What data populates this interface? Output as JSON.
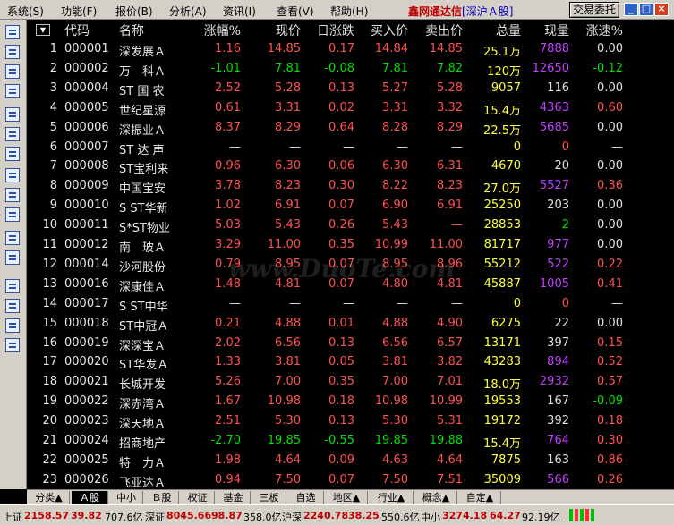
{
  "menu": [
    "系统(S)",
    "功能(F)",
    "报价(B)",
    "分析(A)",
    "资讯(I)",
    "查看(V)",
    "帮助(H)"
  ],
  "app_title": "鑫网通达信",
  "market": "[深沪Ａ股]",
  "trade_button": "交易委托",
  "window_buttons": [
    "_",
    "□",
    "×"
  ],
  "sort_arrow": "▼",
  "columns": [
    "代码",
    "名称",
    "涨幅%",
    "现价",
    "日涨跌",
    "买入价",
    "卖出价",
    "总量",
    "现量",
    "涨速%"
  ],
  "watermark": "www.DuoTe.com",
  "rows": [
    {
      "idx": "1",
      "code": "000001",
      "name": "深发展Ａ",
      "chg": "1.16",
      "price": "14.85",
      "daychg": "0.17",
      "bid": "14.84",
      "ask": "14.85",
      "vol": "25.1万",
      "cur": "7888",
      "speed": "0.00",
      "dir": "up",
      "curc": "magenta",
      "spdc": "flat"
    },
    {
      "idx": "2",
      "code": "000002",
      "name": "万　科Ａ",
      "chg": "-1.01",
      "price": "7.81",
      "daychg": "-0.08",
      "bid": "7.81",
      "ask": "7.82",
      "vol": "120万",
      "cur": "12650",
      "speed": "-0.12",
      "dir": "down",
      "curc": "magenta",
      "spdc": "down"
    },
    {
      "idx": "3",
      "code": "000004",
      "name": "ST 国 农",
      "chg": "2.52",
      "price": "5.28",
      "daychg": "0.13",
      "bid": "5.27",
      "ask": "5.28",
      "vol": "9057",
      "cur": "116",
      "speed": "0.00",
      "dir": "up",
      "curc": "white",
      "spdc": "flat"
    },
    {
      "idx": "4",
      "code": "000005",
      "name": "世纪星源",
      "chg": "0.61",
      "price": "3.31",
      "daychg": "0.02",
      "bid": "3.31",
      "ask": "3.32",
      "vol": "15.4万",
      "cur": "4363",
      "speed": "0.60",
      "dir": "up",
      "curc": "magenta",
      "spdc": "up"
    },
    {
      "idx": "5",
      "code": "000006",
      "name": "深振业Ａ",
      "chg": "8.37",
      "price": "8.29",
      "daychg": "0.64",
      "bid": "8.28",
      "ask": "8.29",
      "vol": "22.5万",
      "cur": "5685",
      "speed": "0.00",
      "dir": "up",
      "curc": "magenta",
      "spdc": "flat"
    },
    {
      "idx": "6",
      "code": "000007",
      "name": "ST 达 声",
      "chg": "—",
      "price": "—",
      "daychg": "—",
      "bid": "—",
      "ask": "—",
      "vol": "0",
      "cur": "0",
      "speed": "—",
      "dir": "flat",
      "curc": "up",
      "spdc": "flat"
    },
    {
      "idx": "7",
      "code": "000008",
      "name": "ST宝利来",
      "chg": "0.96",
      "price": "6.30",
      "daychg": "0.06",
      "bid": "6.30",
      "ask": "6.31",
      "vol": "4670",
      "cur": "20",
      "speed": "0.00",
      "dir": "up",
      "curc": "white",
      "spdc": "flat"
    },
    {
      "idx": "8",
      "code": "000009",
      "name": "中国宝安",
      "chg": "3.78",
      "price": "8.23",
      "daychg": "0.30",
      "bid": "8.22",
      "ask": "8.23",
      "vol": "27.0万",
      "cur": "5527",
      "speed": "0.36",
      "dir": "up",
      "curc": "magenta",
      "spdc": "up"
    },
    {
      "idx": "9",
      "code": "000010",
      "name": "S ST华新",
      "chg": "1.02",
      "price": "6.91",
      "daychg": "0.07",
      "bid": "6.90",
      "ask": "6.91",
      "vol": "25250",
      "cur": "203",
      "speed": "0.00",
      "dir": "up",
      "curc": "white",
      "spdc": "flat"
    },
    {
      "idx": "10",
      "code": "000011",
      "name": "S*ST物业",
      "chg": "5.03",
      "price": "5.43",
      "daychg": "0.26",
      "bid": "5.43",
      "ask": "—",
      "vol": "28853",
      "cur": "2",
      "speed": "0.00",
      "dir": "up",
      "curc": "down",
      "spdc": "flat"
    },
    {
      "idx": "11",
      "code": "000012",
      "name": "南　玻Ａ",
      "chg": "3.29",
      "price": "11.00",
      "daychg": "0.35",
      "bid": "10.99",
      "ask": "11.00",
      "vol": "81717",
      "cur": "977",
      "speed": "0.00",
      "dir": "up",
      "curc": "magenta",
      "spdc": "flat"
    },
    {
      "idx": "12",
      "code": "000014",
      "name": "沙河股份",
      "chg": "0.79",
      "price": "8.95",
      "daychg": "0.07",
      "bid": "8.95",
      "ask": "8.96",
      "vol": "55212",
      "cur": "522",
      "speed": "0.22",
      "dir": "up",
      "curc": "magenta",
      "spdc": "up"
    },
    {
      "idx": "13",
      "code": "000016",
      "name": "深康佳Ａ",
      "chg": "1.48",
      "price": "4.81",
      "daychg": "0.07",
      "bid": "4.80",
      "ask": "4.81",
      "vol": "45887",
      "cur": "1005",
      "speed": "0.41",
      "dir": "up",
      "curc": "magenta",
      "spdc": "up"
    },
    {
      "idx": "14",
      "code": "000017",
      "name": "S ST中华",
      "chg": "—",
      "price": "—",
      "daychg": "—",
      "bid": "—",
      "ask": "—",
      "vol": "0",
      "cur": "0",
      "speed": "—",
      "dir": "flat",
      "curc": "up",
      "spdc": "flat"
    },
    {
      "idx": "15",
      "code": "000018",
      "name": "ST中冠Ａ",
      "chg": "0.21",
      "price": "4.88",
      "daychg": "0.01",
      "bid": "4.88",
      "ask": "4.90",
      "vol": "6275",
      "cur": "22",
      "speed": "0.00",
      "dir": "up",
      "curc": "white",
      "spdc": "flat"
    },
    {
      "idx": "16",
      "code": "000019",
      "name": "深深宝Ａ",
      "chg": "2.02",
      "price": "6.56",
      "daychg": "0.13",
      "bid": "6.56",
      "ask": "6.57",
      "vol": "13171",
      "cur": "397",
      "speed": "0.15",
      "dir": "up",
      "curc": "white",
      "spdc": "up"
    },
    {
      "idx": "17",
      "code": "000020",
      "name": "ST华发Ａ",
      "chg": "1.33",
      "price": "3.81",
      "daychg": "0.05",
      "bid": "3.81",
      "ask": "3.82",
      "vol": "43283",
      "cur": "894",
      "speed": "0.52",
      "dir": "up",
      "curc": "magenta",
      "spdc": "up"
    },
    {
      "idx": "18",
      "code": "000021",
      "name": "长城开发",
      "chg": "5.26",
      "price": "7.00",
      "daychg": "0.35",
      "bid": "7.00",
      "ask": "7.01",
      "vol": "18.0万",
      "cur": "2932",
      "speed": "0.57",
      "dir": "up",
      "curc": "magenta",
      "spdc": "up"
    },
    {
      "idx": "19",
      "code": "000022",
      "name": "深赤湾Ａ",
      "chg": "1.67",
      "price": "10.98",
      "daychg": "0.18",
      "bid": "10.98",
      "ask": "10.99",
      "vol": "19553",
      "cur": "167",
      "speed": "-0.09",
      "dir": "up",
      "curc": "white",
      "spdc": "down"
    },
    {
      "idx": "20",
      "code": "000023",
      "name": "深天地Ａ",
      "chg": "2.51",
      "price": "5.30",
      "daychg": "0.13",
      "bid": "5.30",
      "ask": "5.31",
      "vol": "19172",
      "cur": "392",
      "speed": "0.18",
      "dir": "up",
      "curc": "white",
      "spdc": "up"
    },
    {
      "idx": "21",
      "code": "000024",
      "name": "招商地产",
      "chg": "-2.70",
      "price": "19.85",
      "daychg": "-0.55",
      "bid": "19.85",
      "ask": "19.88",
      "vol": "15.4万",
      "cur": "764",
      "speed": "0.30",
      "dir": "down",
      "curc": "magenta",
      "spdc": "up"
    },
    {
      "idx": "22",
      "code": "000025",
      "name": "特　力Ａ",
      "chg": "1.98",
      "price": "4.64",
      "daychg": "0.09",
      "bid": "4.63",
      "ask": "4.64",
      "vol": "7875",
      "cur": "163",
      "speed": "0.86",
      "dir": "up",
      "curc": "white",
      "spdc": "up"
    },
    {
      "idx": "23",
      "code": "000026",
      "name": "飞亚达Ａ",
      "chg": "0.94",
      "price": "7.50",
      "daychg": "0.07",
      "bid": "7.50",
      "ask": "7.51",
      "vol": "35009",
      "cur": "566",
      "speed": "0.26",
      "dir": "up",
      "curc": "magenta",
      "spdc": "up"
    }
  ],
  "tabs": [
    "分类▲",
    "Ａ股",
    "中小",
    "Ｂ股",
    "权证",
    "基金",
    "三板",
    "自选",
    "地区▲",
    "行业▲",
    "概念▲",
    "自定▲"
  ],
  "active_tab": "Ａ股",
  "status": {
    "sh_label": "上证",
    "sh_index": "2158.57",
    "sh_chg": "39.82",
    "sh_amt": "707.6亿",
    "sz_label": "深证",
    "sz_index": "8045.66",
    "sz_chg": "98.87",
    "sz_amt": "358.0亿",
    "hs_label": "沪深",
    "hs_index": "2240.78",
    "hs_chg": "38.25",
    "hs_amt": "550.6亿",
    "zx_label": "中小",
    "zx_index": "3274.18",
    "zx_chg": "64.27",
    "zx_amt": "92.19亿"
  },
  "colors": {
    "up": "#ff5050",
    "down": "#00e000",
    "bg": "#000000"
  }
}
